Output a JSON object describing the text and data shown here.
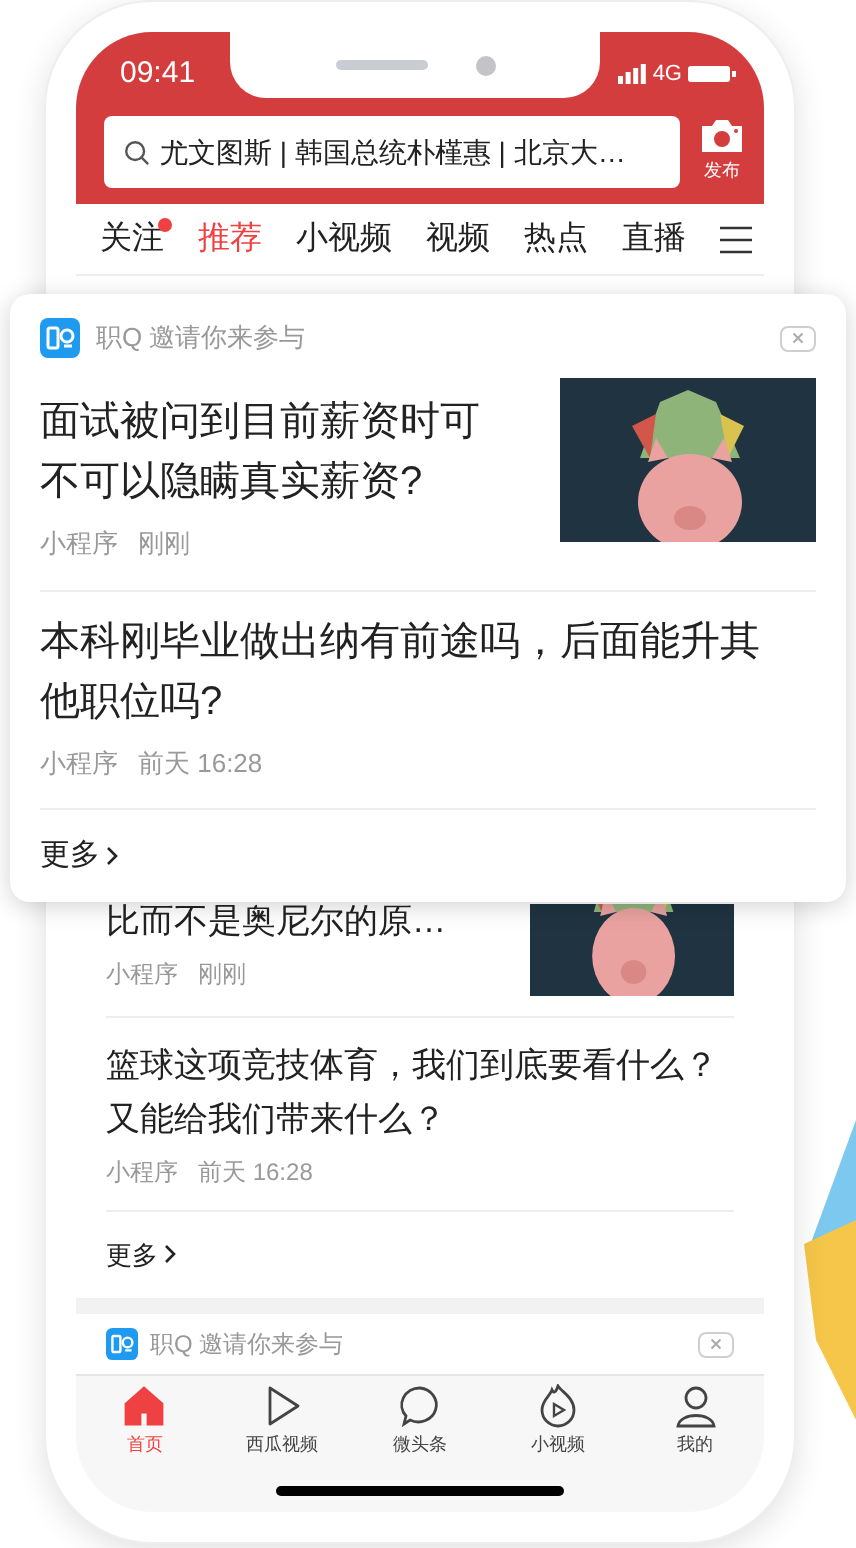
{
  "status_bar": {
    "time": "09:41",
    "network": "4G"
  },
  "search": {
    "placeholder": "尤文图斯 | 韩国总统朴槿惠 | 北京大…",
    "publish": "发布"
  },
  "tabs": [
    {
      "label": "关注",
      "selected": false,
      "dot": true
    },
    {
      "label": "推荐",
      "selected": true,
      "dot": false
    },
    {
      "label": "小视频",
      "selected": false,
      "dot": false
    },
    {
      "label": "视频",
      "selected": false,
      "dot": false
    },
    {
      "label": "热点",
      "selected": false,
      "dot": false
    },
    {
      "label": "直播",
      "selected": false,
      "dot": false
    }
  ],
  "feed": {
    "articles": [
      {
        "kind": "image",
        "title": "比而不是奥尼尔的原…",
        "source": "小程序",
        "time": "刚刚"
      },
      {
        "kind": "text",
        "title": "篮球这项竞技体育，我们到底要看什么？又能给我们带来什么？",
        "source": "小程序",
        "time": "前天 16:28"
      }
    ],
    "more": "更多",
    "next_card": {
      "header": "职Q 邀请你来参与"
    }
  },
  "popup": {
    "header": "职Q 邀请你来参与",
    "articles": [
      {
        "kind": "image",
        "title": "面试被问到目前薪资时可不可以隐瞒真实薪资?",
        "source": "小程序",
        "time": "刚刚"
      },
      {
        "kind": "text",
        "title": "本科刚毕业做出纳有前途吗，后面能升其他职位吗?",
        "source": "小程序",
        "time": "前天 16:28"
      }
    ],
    "more": "更多"
  },
  "bottom_nav": [
    {
      "kind": "home",
      "label": "首页",
      "selected": true
    },
    {
      "kind": "play",
      "label": "西瓜视频",
      "selected": false
    },
    {
      "kind": "chat",
      "label": "微头条",
      "selected": false
    },
    {
      "kind": "flame",
      "label": "小视频",
      "selected": false
    },
    {
      "kind": "person",
      "label": "我的",
      "selected": false
    }
  ]
}
